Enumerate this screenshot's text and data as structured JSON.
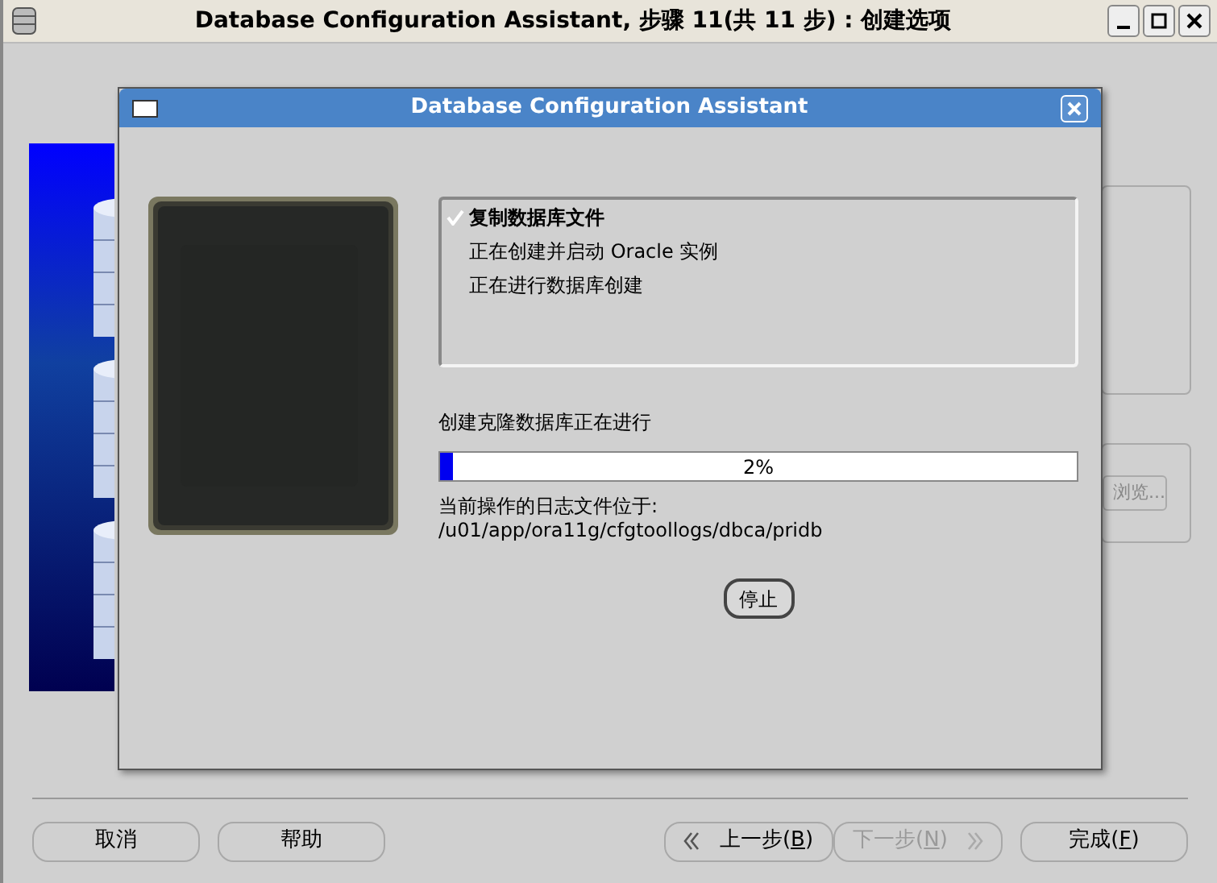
{
  "window": {
    "title": "Database Configuration Assistant, 步骤 11(共 11 步) : 创建选项"
  },
  "background_panel": {
    "browse_button": "浏览..."
  },
  "dialog": {
    "title": "Database Configuration Assistant",
    "steps": [
      {
        "label": "复制数据库文件",
        "checked": true
      },
      {
        "label": "正在创建并启动 Oracle 实例",
        "checked": false
      },
      {
        "label": "正在进行数据库创建",
        "checked": false
      }
    ],
    "status": "创建克隆数据库正在进行",
    "progress": {
      "level": 0.02,
      "reading": "2%"
    },
    "log_label": "当前操作的日志文件位于:",
    "log_path": "/u01/app/ora11g/cfgtoollogs/dbca/pridb",
    "stop_button": "停止"
  },
  "buttons": [
    {
      "kind": "plain",
      "pre": "取消",
      "disabled": false
    },
    {
      "kind": "plain",
      "pre": "帮助",
      "disabled": false
    },
    {
      "kind": "back",
      "pre": "上一步(",
      "key": "B",
      "post": ")",
      "disabled": false
    },
    {
      "kind": "next",
      "pre": "下一步(",
      "key": "N",
      "post": ")",
      "disabled": true
    },
    {
      "kind": "plain",
      "pre": "完成(",
      "key": "F",
      "post": ")",
      "disabled": false
    }
  ]
}
